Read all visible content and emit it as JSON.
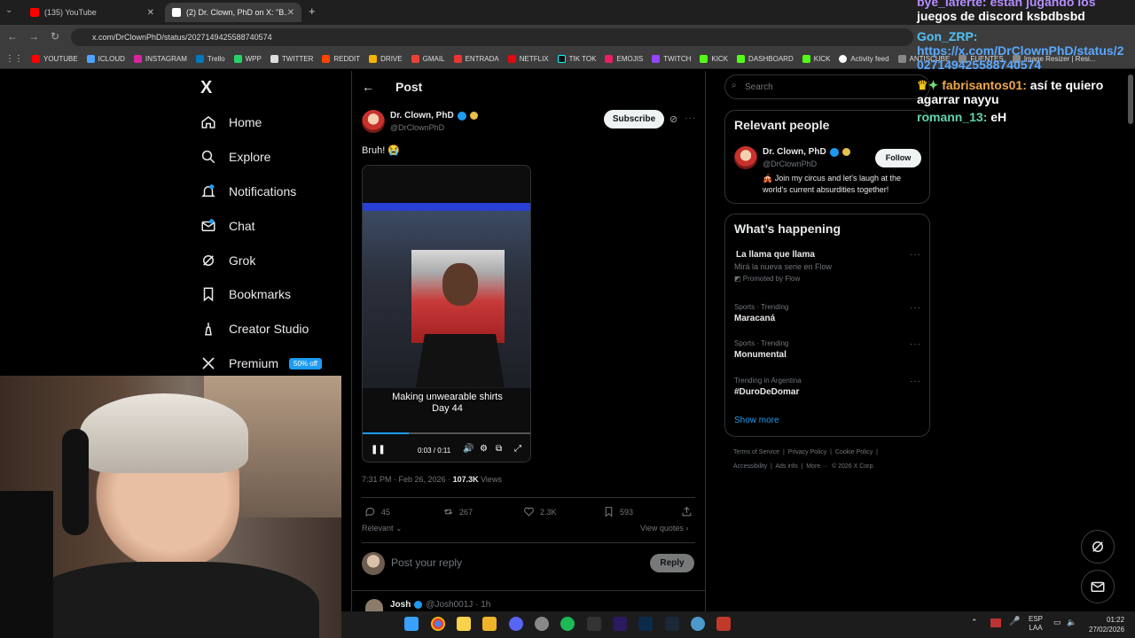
{
  "browser": {
    "tabs": [
      {
        "label": "(135) YouTube",
        "color": "#ff0000"
      },
      {
        "label": "(2) Dr. Clown, PhD on X: \"B...",
        "color": "#ffffff"
      }
    ],
    "url": "x.com/DrClownPhD/status/2027149425588740574",
    "bookmarks": [
      "YOUTUBE",
      "ICLOUD",
      "INSTAGRAM",
      "Trello",
      "WPP",
      "TWITTER",
      "REDDIT",
      "DRIVE",
      "GMAIL",
      "ENTRADA",
      "NETFLIX",
      "TIK TOK",
      "EMOJIS",
      "TWITCH",
      "KICK",
      "DASHBOARD",
      "KICK",
      "Activity feed",
      "ANTISCUBE",
      "FUENTES",
      "Image Resizer | Resi..."
    ]
  },
  "nav": {
    "items": [
      {
        "label": "Home",
        "icon": "home-icon"
      },
      {
        "label": "Explore",
        "icon": "search-icon"
      },
      {
        "label": "Notifications",
        "icon": "bell-icon"
      },
      {
        "label": "Chat",
        "icon": "mail-icon"
      },
      {
        "label": "Grok",
        "icon": "grok-icon"
      },
      {
        "label": "Bookmarks",
        "icon": "bookmark-icon"
      },
      {
        "label": "Creator Studio",
        "icon": "creator-icon"
      },
      {
        "label": "Premium",
        "icon": "x-icon"
      }
    ],
    "premium_badge": "50% off",
    "logo": "X"
  },
  "post": {
    "header": "Post",
    "author_name": "Dr. Clown, PhD",
    "author_handle": "@DrClownPhD",
    "subscribe_label": "Subscribe",
    "text": "Bruh! 😭",
    "video_caption_line1": "Making unwearable shirts",
    "video_caption_line2": "Day 44",
    "video_time": "0:03 / 0:11",
    "timestamp": "7:31 PM · Feb 26, 2026 · ",
    "views_count": "107.3K",
    "views_label": " Views",
    "stats": {
      "replies": "45",
      "reposts": "267",
      "likes": "2.3K",
      "bookmarks": "593"
    },
    "sort_label": "Relevant",
    "view_quotes": "View quotes",
    "reply_placeholder": "Post your reply",
    "reply_button": "Reply",
    "next_reply_name": "Josh",
    "next_reply_meta": "@Josh001J · 1h"
  },
  "sidebar": {
    "search_placeholder": "Search",
    "relevant_title": "Relevant people",
    "person_name": "Dr. Clown, PhD",
    "person_handle": "@DrClownPhD",
    "follow_label": "Follow",
    "person_bio": "🎪 Join my circus and let's laugh at the world's current absurdities together!",
    "happening_title": "What’s happening",
    "trends": [
      {
        "meta": "",
        "title": "La llama que llama",
        "sub": "Mirá la nueva serie en Flow",
        "promo": "Promoted by Flow"
      },
      {
        "meta": "Sports · Trending",
        "title": "Maracaná"
      },
      {
        "meta": "Sports · Trending",
        "title": "Monumental"
      },
      {
        "meta": "Trending in Argentina",
        "title": "#DuroDeDomar"
      }
    ],
    "show_more": "Show more",
    "footer_line1": "Terms of Service  |  Privacy Policy  |  Cookie Policy  |",
    "footer_line2": "Accessibility  |  Ads info  |  More ···  © 2026 X Corp."
  },
  "chat_overlay": {
    "line1": "bye_laferte: están jugando los",
    "line2": "juegos de discord ksbdbsbd",
    "msg2_user": "Gon_ZRP:",
    "msg2_text": "https://x.com/DrClownPhD/status/2027149425588740574",
    "msg3_user": "fabrisantos01:",
    "msg3_text": " así te quiero agarrar nayyu",
    "msg4_user": "romann_13:",
    "msg4_text": " eH"
  },
  "taskbar": {
    "lang": "ESP",
    "lang2": "LAA",
    "time": "01:22",
    "date": "27/02/2026"
  }
}
